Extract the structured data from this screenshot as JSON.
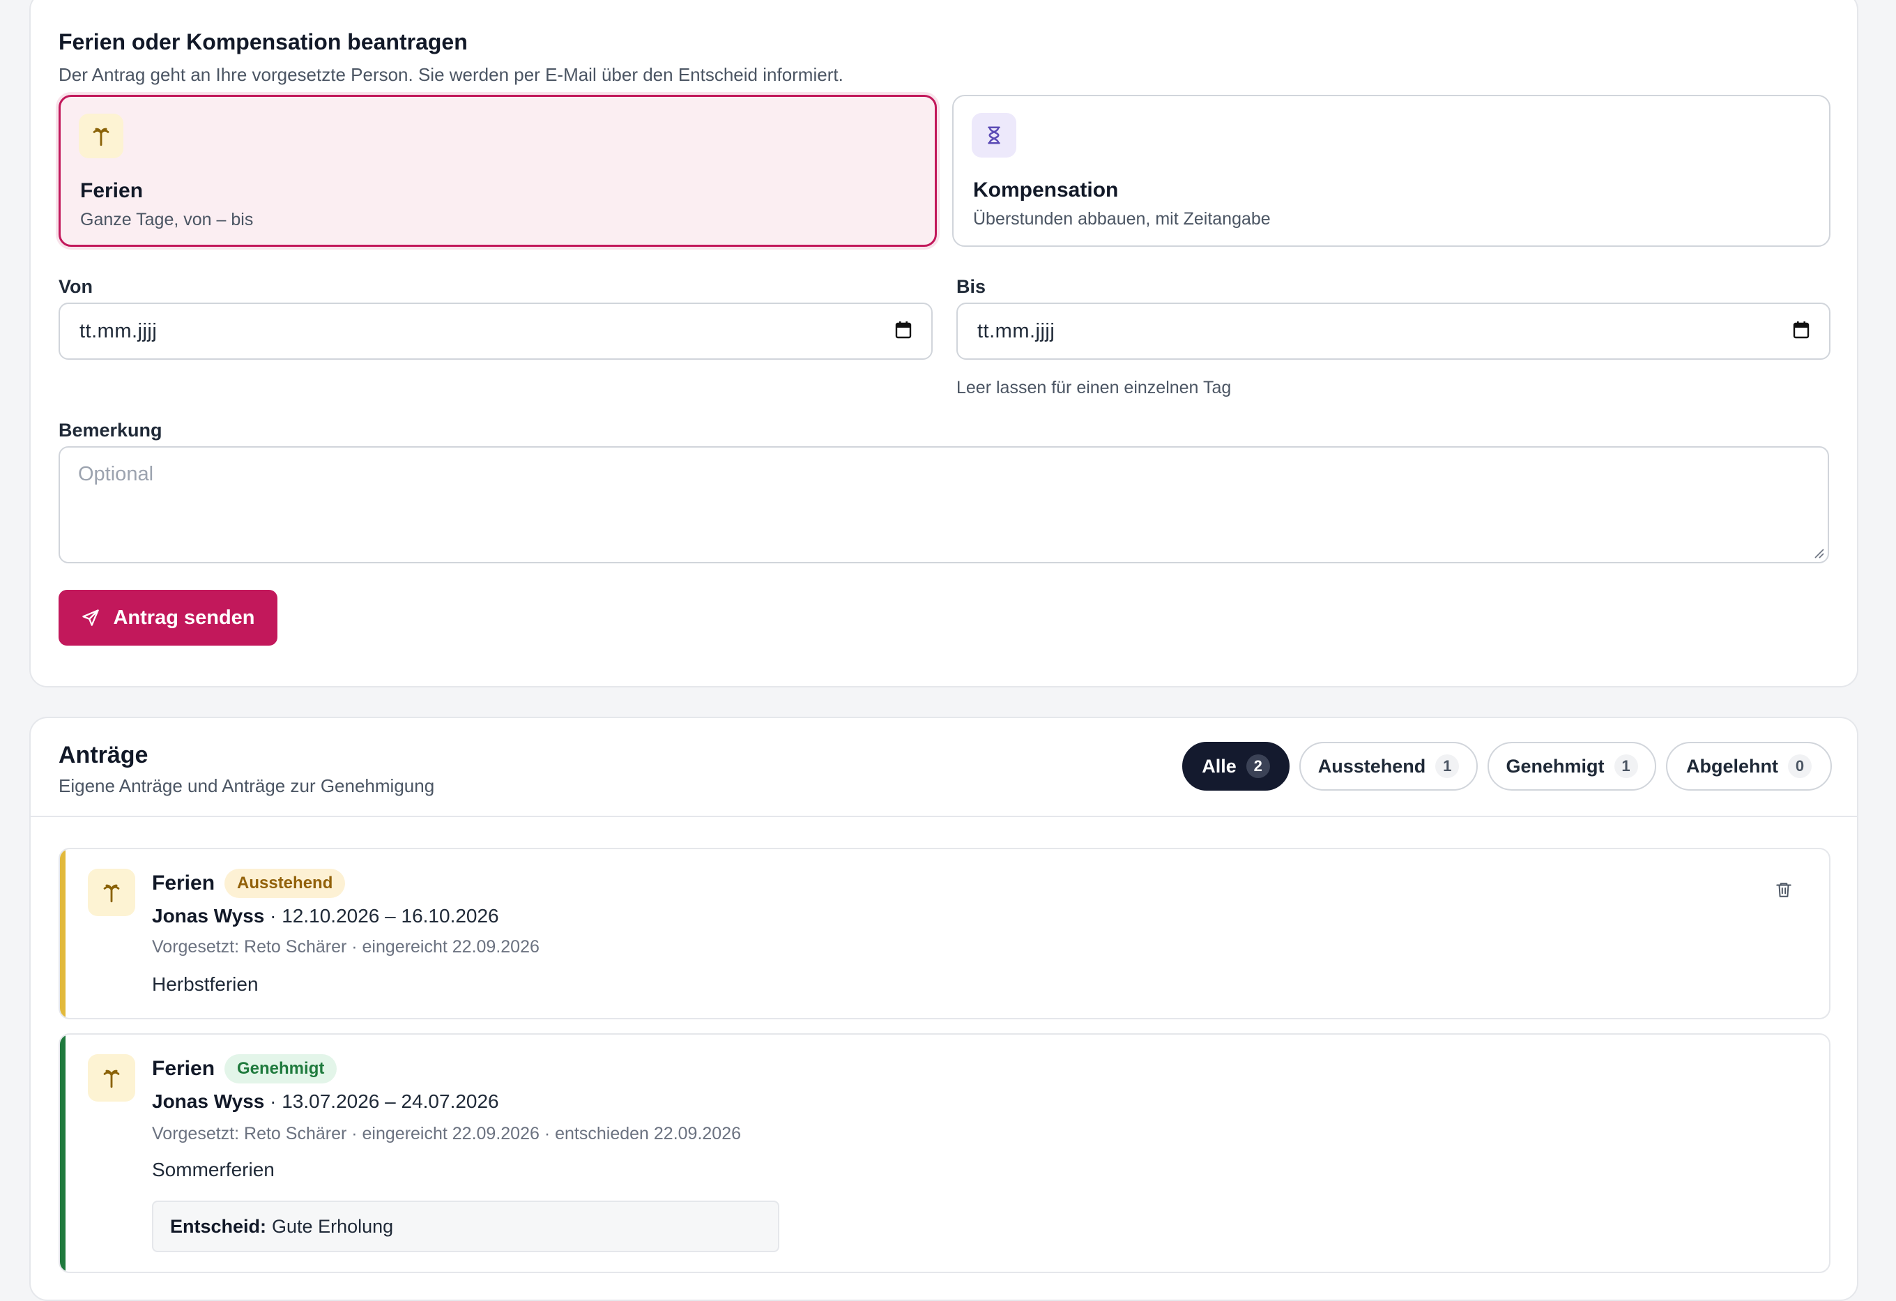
{
  "request_form": {
    "title": "Ferien oder Kompensation beantragen",
    "subtitle": "Der Antrag geht an Ihre vorgesetzte Person. Sie werden per E-Mail über den Entscheid informiert.",
    "types": [
      {
        "icon": "palm-tree-icon",
        "title": "Ferien",
        "description": "Ganze Tage, von – bis",
        "selected": true
      },
      {
        "icon": "hourglass-icon",
        "title": "Kompensation",
        "description": "Überstunden abbauen, mit Zeitangabe",
        "selected": false
      }
    ],
    "from": {
      "label": "Von",
      "value": "tt.mm.jjjj"
    },
    "to": {
      "label": "Bis",
      "value": "tt.mm.jjjj",
      "hint": "Leer lassen für einen einzelnen Tag"
    },
    "note": {
      "label": "Bemerkung",
      "placeholder": "Optional"
    },
    "submit_label": "Antrag senden",
    "accent_color": "#c2185b"
  },
  "requests": {
    "title": "Anträge",
    "subtitle": "Eigene Anträge und Anträge zur Genehmigung",
    "filters": [
      {
        "label": "Alle",
        "count": "2",
        "active": true
      },
      {
        "label": "Ausstehend",
        "count": "1",
        "active": false
      },
      {
        "label": "Genehmigt",
        "count": "1",
        "active": false
      },
      {
        "label": "Abgelehnt",
        "count": "0",
        "active": false
      }
    ],
    "items": [
      {
        "type": "Ferien",
        "status": "Ausstehend",
        "status_color": "#e2b93b",
        "person": "Jonas Wyss",
        "period": " · 12.10.2026 – 16.10.2026",
        "meta": "Vorgesetzt: Reto Schärer · eingereicht 22.09.2026",
        "note": "Herbstferien"
      },
      {
        "type": "Ferien",
        "status": "Genehmigt",
        "status_color": "#1f7a3d",
        "person": "Jonas Wyss",
        "period": " · 13.07.2026 – 24.07.2026",
        "meta": "Vorgesetzt: Reto Schärer · eingereicht 22.09.2026 · entschieden 22.09.2026",
        "note": "Sommerferien",
        "decision_label": "Entscheid:",
        "decision_text": "Gute Erholung"
      }
    ]
  }
}
